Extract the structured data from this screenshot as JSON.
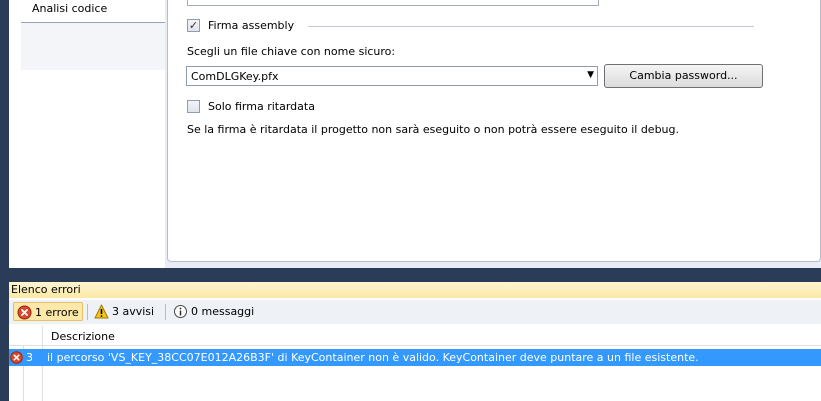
{
  "sidebar": {
    "tab_label": "Analisi codice"
  },
  "signing": {
    "sign_assembly_label": "Firma assembly",
    "sign_assembly_checked": true,
    "choose_key_label": "Scegli un file chiave con nome sicuro:",
    "key_file_value": "ComDLGKey.pfx",
    "change_password_label": "Cambia password...",
    "delay_sign_label": "Solo firma ritardata",
    "delay_sign_checked": false,
    "delay_sign_info": "Se la firma è ritardata il progetto non sarà eseguito o non potrà essere eseguito il debug."
  },
  "error_list": {
    "title": "Elenco errori",
    "filters": {
      "errors_label": "1 errore",
      "warnings_label": "3 avvisi",
      "messages_label": "0 messaggi"
    },
    "columns": {
      "description": "Descrizione"
    },
    "rows": [
      {
        "number": "3",
        "description": "il percorso 'VS_KEY_38CC07E012A26B3F' di KeyContainer non è valido. KeyContainer deve puntare a un file esistente."
      }
    ]
  },
  "colors": {
    "selection": "#3399ff",
    "title_band": "#fbe9a6",
    "error_icon": "#d9482b",
    "warning_icon": "#f5c518"
  }
}
